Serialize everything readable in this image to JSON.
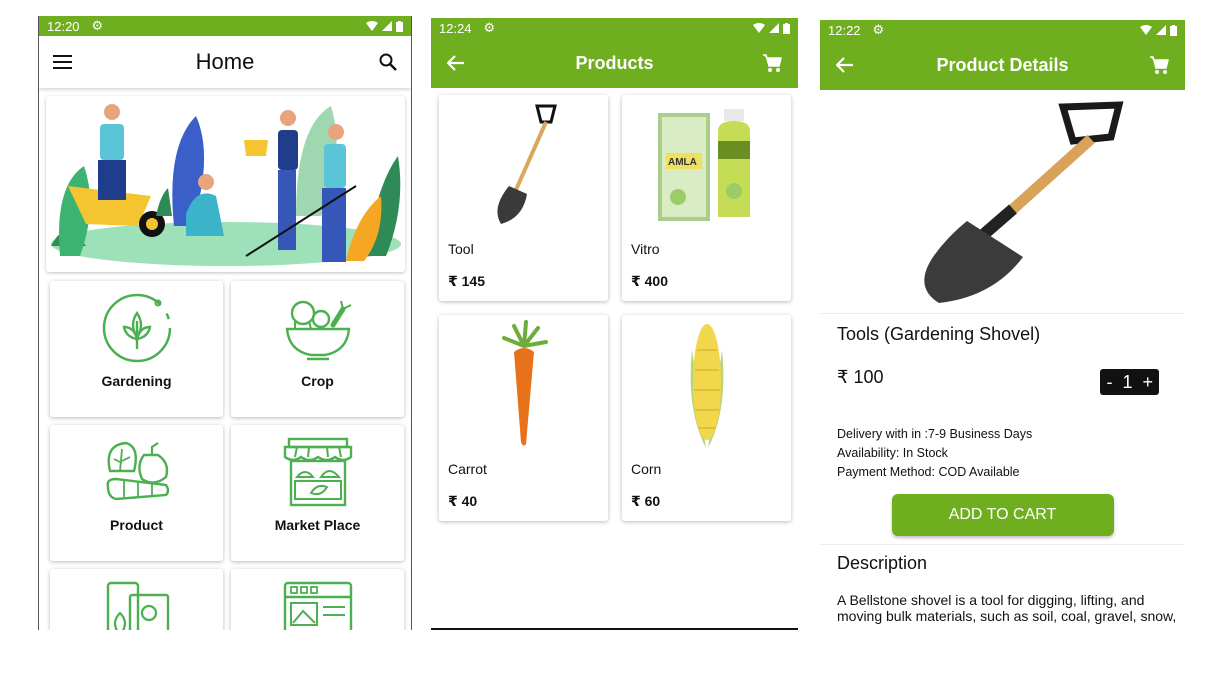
{
  "colors": {
    "accent": "#6faf1f",
    "icon_green": "#4caf50"
  },
  "home": {
    "status_time": "12:20",
    "title": "Home",
    "categories": [
      {
        "label": "Gardening",
        "icon": "wheat-leaf-icon"
      },
      {
        "label": "Crop",
        "icon": "vegetable-bowl-icon"
      },
      {
        "label": "Product",
        "icon": "vegetables-icon"
      },
      {
        "label": "Market Place",
        "icon": "market-stall-icon"
      },
      {
        "label": "",
        "icon": "mobile-plant-icon"
      },
      {
        "label": "",
        "icon": "web-page-icon"
      }
    ]
  },
  "products": {
    "status_time": "12:24",
    "title": "Products",
    "items": [
      {
        "name": "Tool",
        "price": "₹ 145",
        "image": "shovel"
      },
      {
        "name": "Vitro",
        "price": "₹ 400",
        "image": "amla-juice"
      },
      {
        "name": "Carrot",
        "price": "₹ 40",
        "image": "carrot"
      },
      {
        "name": "Corn",
        "price": "₹ 60",
        "image": "corn"
      }
    ]
  },
  "details": {
    "status_time": "12:22",
    "title": "Product Details",
    "name": "Tools (Gardening Shovel)",
    "price": "₹ 100",
    "quantity": "1",
    "minus": "-",
    "plus": "+",
    "delivery": "Delivery with in :7-9 Business Days",
    "availability": "Availability: In Stock",
    "payment": "Payment Method: COD Available",
    "add_to_cart": "ADD TO CART",
    "description_title": "Description",
    "description_text": "A Bellstone shovel is a tool for digging, lifting, and moving bulk materials, such as soil, coal, gravel, snow,"
  }
}
